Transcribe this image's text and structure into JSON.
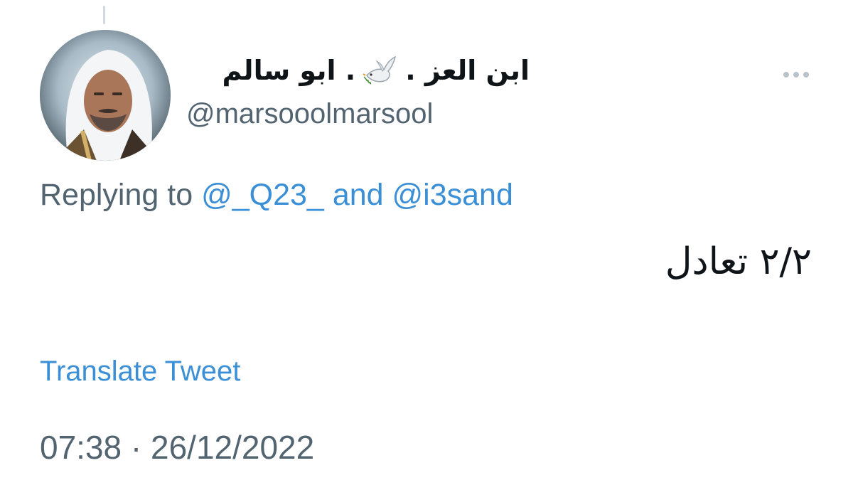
{
  "tweet": {
    "author": {
      "display_name": "ابن العز . 🕊️ . ابو سالم",
      "name_part_1": "ابن العز .",
      "name_part_2": ". ابو سالم",
      "name_emoji": "dove-icon",
      "handle": "@marsooolmarsool",
      "avatar": "profile-photo"
    },
    "more_icon": "more-horizontal-icon",
    "replying": {
      "prefix": "Replying to",
      "user1": "@_Q23_",
      "conjunction": "and",
      "user2": "@i3sand"
    },
    "text": "٢/٢ تعادل",
    "translate_label": "Translate Tweet",
    "timestamp": "07:38 · 26/12/2022"
  },
  "colors": {
    "link": "#3a8fd6",
    "secondary_text": "#536471",
    "primary_text": "#0f1419",
    "background": "#ffffff"
  }
}
